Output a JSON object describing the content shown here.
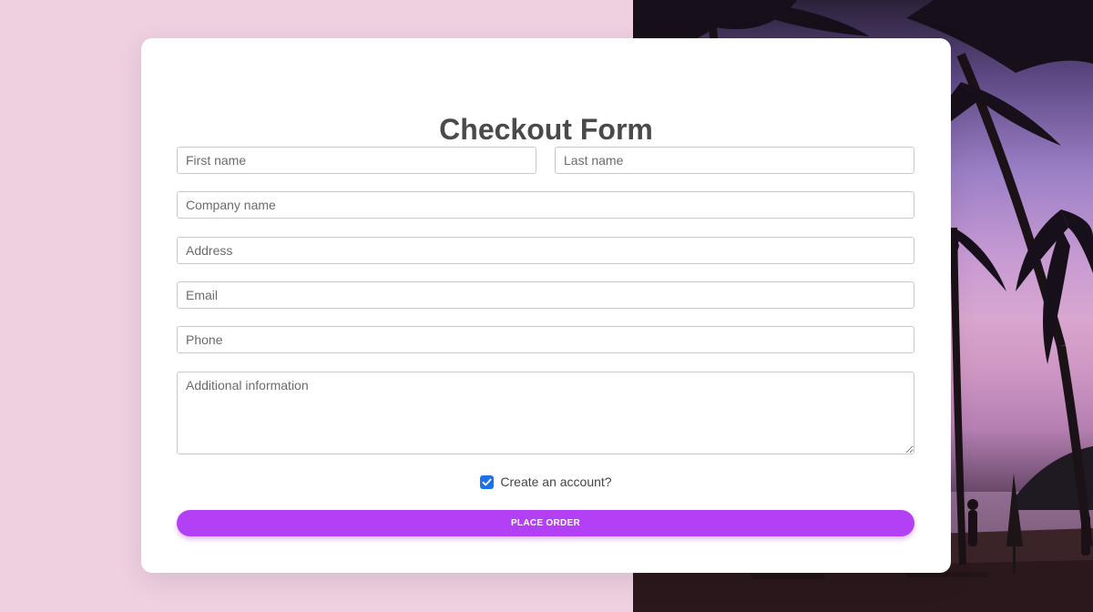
{
  "form": {
    "title": "Checkout Form",
    "fields": {
      "first_name": {
        "placeholder": "First name",
        "value": ""
      },
      "last_name": {
        "placeholder": "Last name",
        "value": ""
      },
      "company": {
        "placeholder": "Company name",
        "value": ""
      },
      "address": {
        "placeholder": "Address",
        "value": ""
      },
      "email": {
        "placeholder": "Email",
        "value": ""
      },
      "phone": {
        "placeholder": "Phone",
        "value": ""
      },
      "additional": {
        "placeholder": "Additional information",
        "value": ""
      }
    },
    "create_account": {
      "label": "Create an account?",
      "checked": true
    },
    "submit_label": "PLACE ORDER"
  },
  "colors": {
    "page_background": "#efd0e1",
    "card_background": "#ffffff",
    "title_text": "#4a4a4a",
    "accent_button": "#b440f5",
    "checkbox_checked": "#1a73e8"
  },
  "icons": {
    "checkbox": "check-icon"
  }
}
